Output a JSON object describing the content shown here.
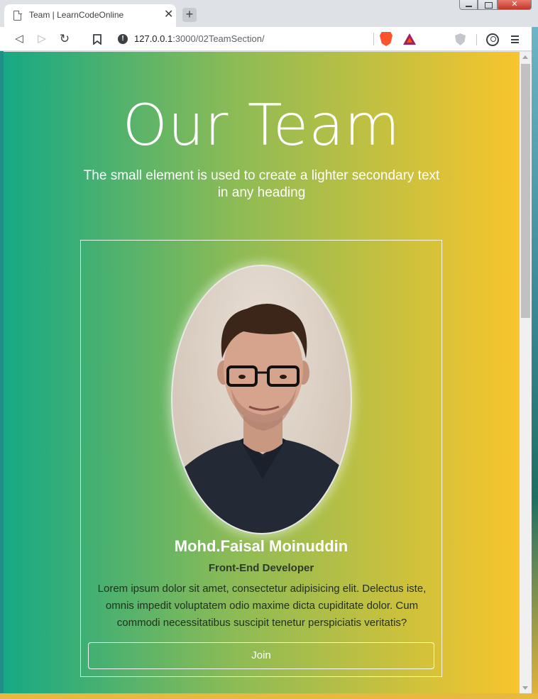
{
  "browser": {
    "tab_title": "Team | LearnCodeOnline",
    "tab_close": "✕",
    "new_tab": "+",
    "url_host": "127.0.0.1",
    "url_rest": ":3000/02TeamSection/",
    "info_glyph": "!"
  },
  "page": {
    "heading": "Our Team",
    "subheading": "The small element is used to create a lighter secondary text in any heading"
  },
  "card": {
    "name": "Mohd.Faisal Moinuddin",
    "role": "Front-End Developer",
    "bio": "Lorem ipsum dolor sit amet, consectetur adipisicing elit. Delectus iste, omnis impedit voluptatem odio maxime dicta cupiditate dolor. Cum commodi necessitatibus suscipit tenetur perspiciatis veritatis?",
    "button_label": "Join"
  },
  "colors": {
    "gradient_start": "#16a984",
    "gradient_end": "#f8c52c"
  }
}
